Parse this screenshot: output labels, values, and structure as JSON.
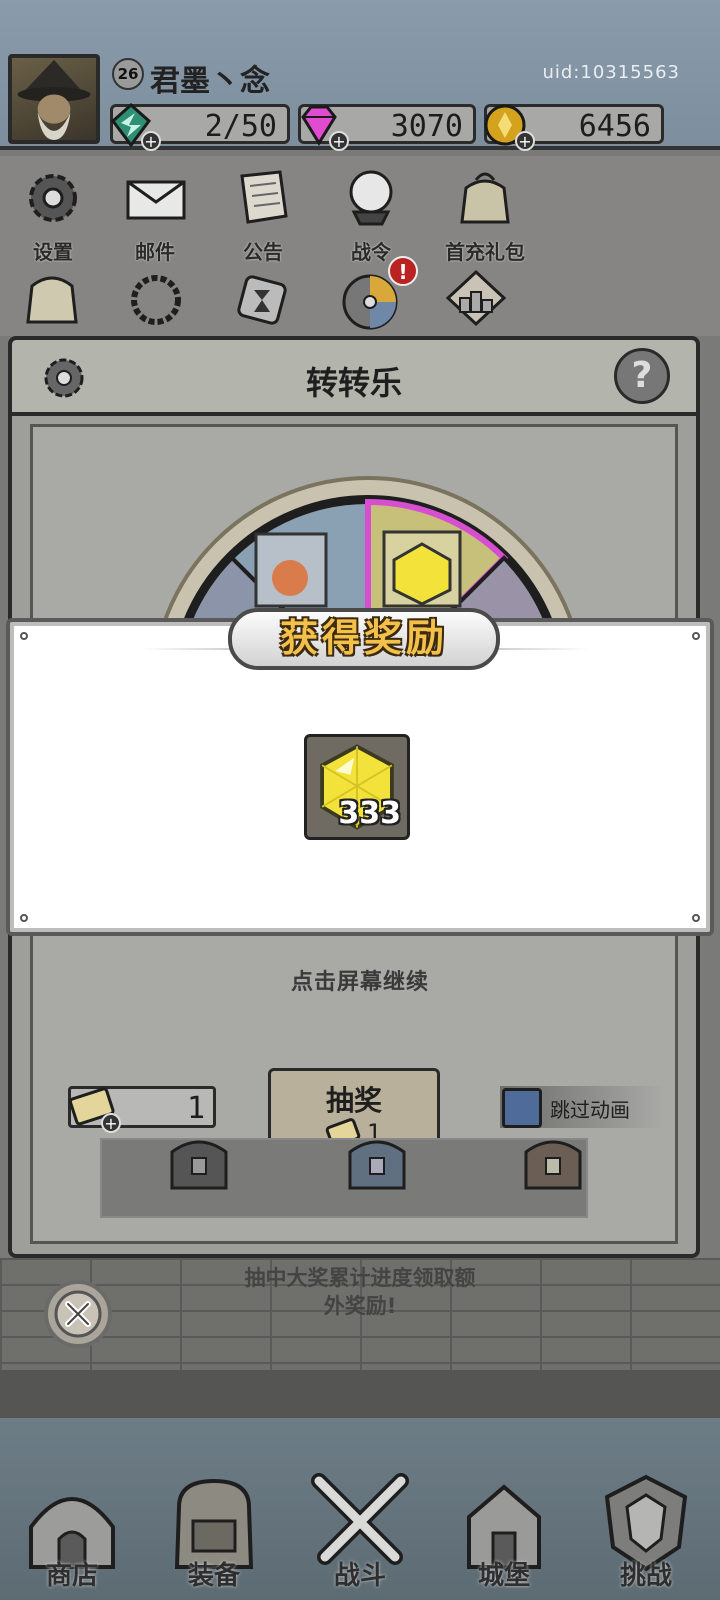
{
  "player": {
    "level": "26",
    "name": "君墨丶念",
    "uid": "uid:10315563"
  },
  "resources": {
    "energy": "2/50",
    "gems": "3070",
    "coins": "6456"
  },
  "menu": {
    "row1": [
      {
        "label": "设置",
        "icon": "gear-icon"
      },
      {
        "label": "邮件",
        "icon": "envelope-icon"
      },
      {
        "label": "公告",
        "icon": "scroll-icon"
      },
      {
        "label": "战令",
        "icon": "crystal-ball-icon"
      },
      {
        "label": "首充礼包",
        "icon": "gift-bag-icon"
      }
    ],
    "row2_badge": "!"
  },
  "spin_panel": {
    "title": "转转乐",
    "help_glyph": "?",
    "continue_hint": "点击屏幕继续",
    "ticket_count": "1",
    "draw_label": "抽奖",
    "draw_cost": "1",
    "skip_label": "跳过动画",
    "bottom_note_line1": "抽中大奖累计进度领取额",
    "bottom_note_line2": "外奖励!"
  },
  "reward_dialog": {
    "title": "获得奖励",
    "item_icon": "yellow-gem-icon",
    "quantity": "333"
  },
  "nav": {
    "items": [
      {
        "label": "商店",
        "icon": "shop-hut-icon"
      },
      {
        "label": "装备",
        "icon": "backpack-icon"
      },
      {
        "label": "战斗",
        "icon": "crossed-swords-icon"
      },
      {
        "label": "城堡",
        "icon": "castle-icon"
      },
      {
        "label": "挑战",
        "icon": "crest-icon"
      }
    ]
  },
  "colors": {
    "reward_title": "#f3c04a",
    "skip_checkbox": "#4e6b9a",
    "alert_badge": "#b22222",
    "gem_yellow": "#f2e23a"
  }
}
